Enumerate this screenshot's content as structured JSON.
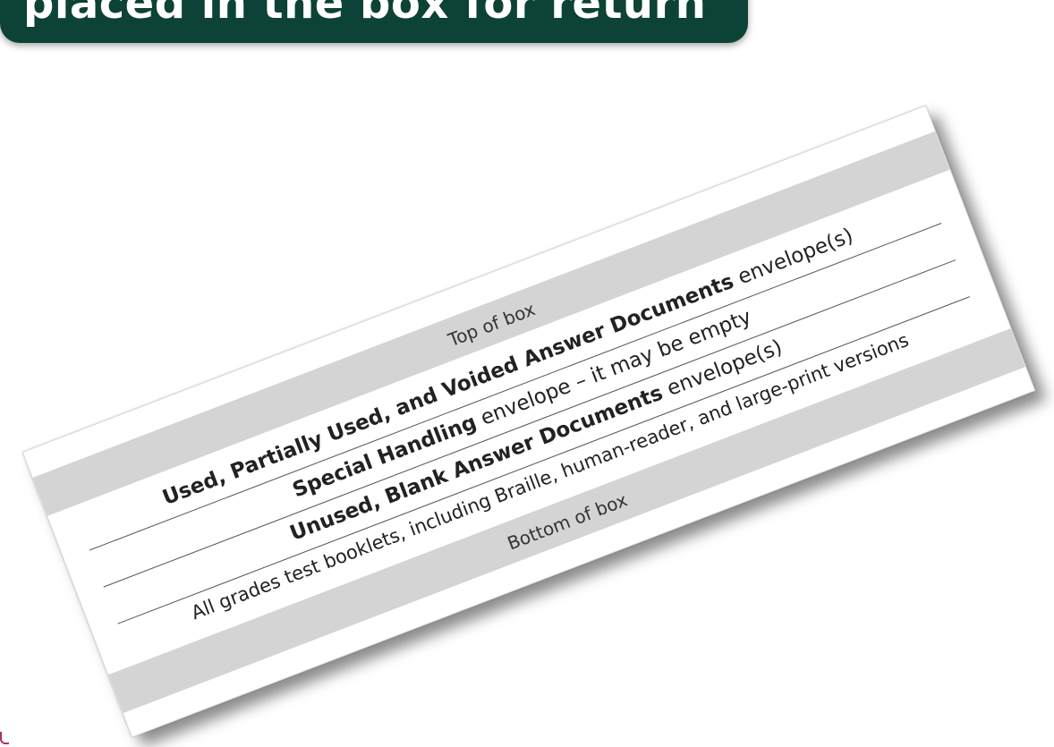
{
  "banner": {
    "text": "placed in the box for return",
    "color": "#0d4236"
  },
  "card": {
    "top_label": "Top of box",
    "rows": [
      {
        "bold": "Used, Partially Used, and Voided Answer Documents",
        "normal": " envelope(s)"
      },
      {
        "bold": "Special Handling",
        "normal": " envelope – it may be empty"
      },
      {
        "bold": "Unused, Blank Answer Documents",
        "normal": " envelope(s)"
      },
      {
        "bold": "",
        "normal": "All grades test booklets, including Braille, human-reader, and large-print versions"
      }
    ],
    "bottom_label": "Bottom of box",
    "band_color": "#d4d4d4"
  }
}
